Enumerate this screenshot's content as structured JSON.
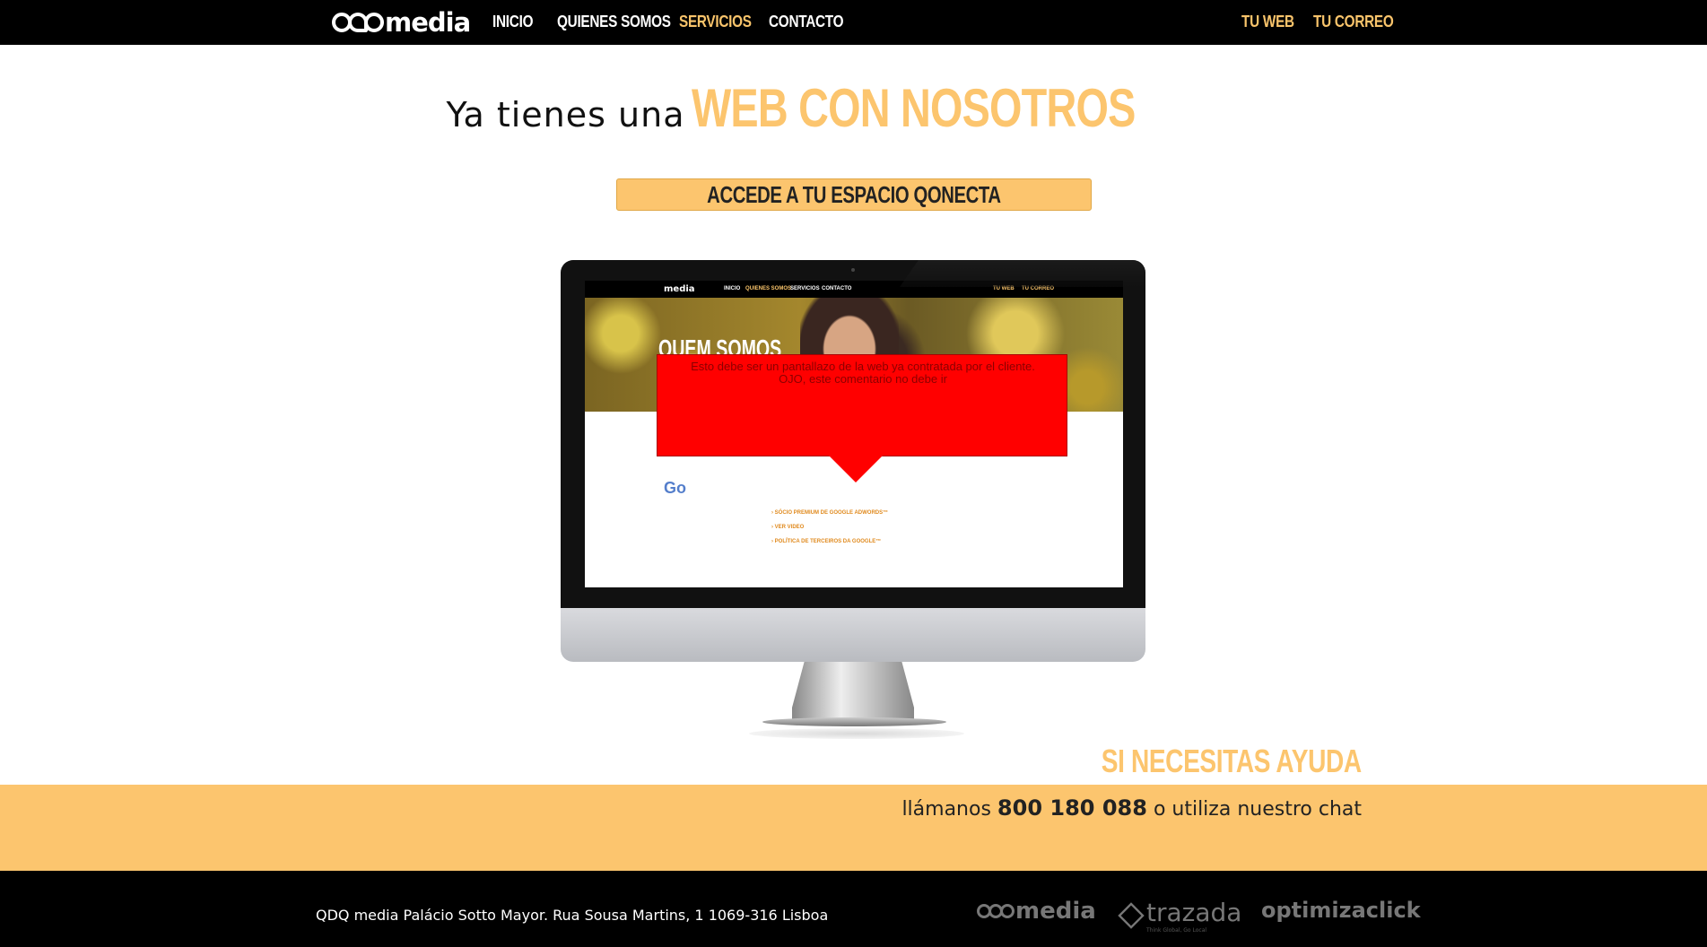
{
  "nav": {
    "logo_text": "media",
    "links": [
      "INICIO",
      "QUIENES SOMOS",
      "SERVICIOS",
      "CONTACTO"
    ],
    "right_links": [
      "TU WEB",
      "TU CORREO"
    ],
    "active": "SERVICIOS"
  },
  "hero": {
    "headline_light": "Ya tienes una",
    "headline_bold": "WEB CON NOSOTROS",
    "cta_label": "ACCEDE A TU ESPACIO QONECTA"
  },
  "monitor_preview": {
    "logo_text": "media",
    "nav_links": [
      "INICIO",
      "QUIENES SOMOS",
      "SERVICIOS",
      "CONTACTO"
    ],
    "nav_right": [
      "TU WEB",
      "TU CORREO"
    ],
    "heading": "QUEM SOMOS",
    "list_items": [
      "SÓCIO PREMIUM DE GOOGLE ADWORDS™",
      "VER VIDEO",
      "POLÍTICA DE TERCEIROS DA GOOGLE™"
    ]
  },
  "callout": {
    "line1": "Esto debe ser un pantallazo de la web ya contratada por el cliente.",
    "line2": "OJO, este comentario no debe ir"
  },
  "help": {
    "title": "SI NECESITAS AYUDA",
    "prefix": "llámanos",
    "phone": "800 180 088",
    "suffix": "o utiliza nuestro chat"
  },
  "footer": {
    "address": "QDQ media Palácio Sotto Mayor. Rua Sousa Martins, 1 1069-316 Lisboa",
    "partners": [
      "media",
      "trazada",
      "optimizaclick"
    ],
    "trazada_tagline": "Think Global, Go Local"
  },
  "colors": {
    "accent": "#fcc56e",
    "nav_bg": "#000000",
    "callout": "#ff0000"
  }
}
